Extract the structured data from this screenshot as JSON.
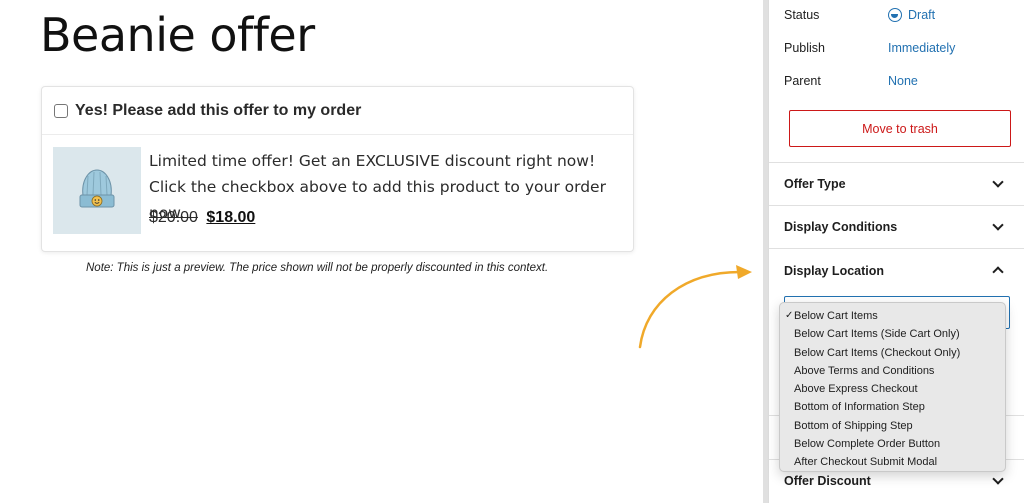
{
  "page": {
    "title": "Beanie offer"
  },
  "offer": {
    "checkbox_label": "Yes! Please add this offer to my order",
    "description": "Limited time offer! Get an EXCLUSIVE discount right now! Click the checkbox above to add this product to your order now.",
    "old_price": "$20.00",
    "new_price": "$18.00",
    "product_image": "beanie-hat-image",
    "checked": false
  },
  "preview_note": "Note: This is just a preview. The price shown will not be properly discounted in this context.",
  "sidebar": {
    "status_label": "Status",
    "status_value": "Draft",
    "publish_label": "Publish",
    "publish_value": "Immediately",
    "parent_label": "Parent",
    "parent_value": "None",
    "trash_label": "Move to trash",
    "panels": {
      "offer_type": "Offer Type",
      "display_conditions": "Display Conditions",
      "display_location": "Display Location",
      "offer_discount": "Offer Discount"
    }
  },
  "dropdown": {
    "selected_index": 0,
    "options": [
      "Below Cart Items",
      "Below Cart Items (Side Cart Only)",
      "Below Cart Items (Checkout Only)",
      "Above Terms and Conditions",
      "Above Express Checkout",
      "Bottom of Information Step",
      "Bottom of Shipping Step",
      "Below Complete Order Button",
      "After Checkout Submit Modal"
    ]
  },
  "colors": {
    "accent": "#2271b1",
    "danger": "#cc1818",
    "arrow": "#f0a92a",
    "thumb_bg": "#dbe7ec"
  }
}
